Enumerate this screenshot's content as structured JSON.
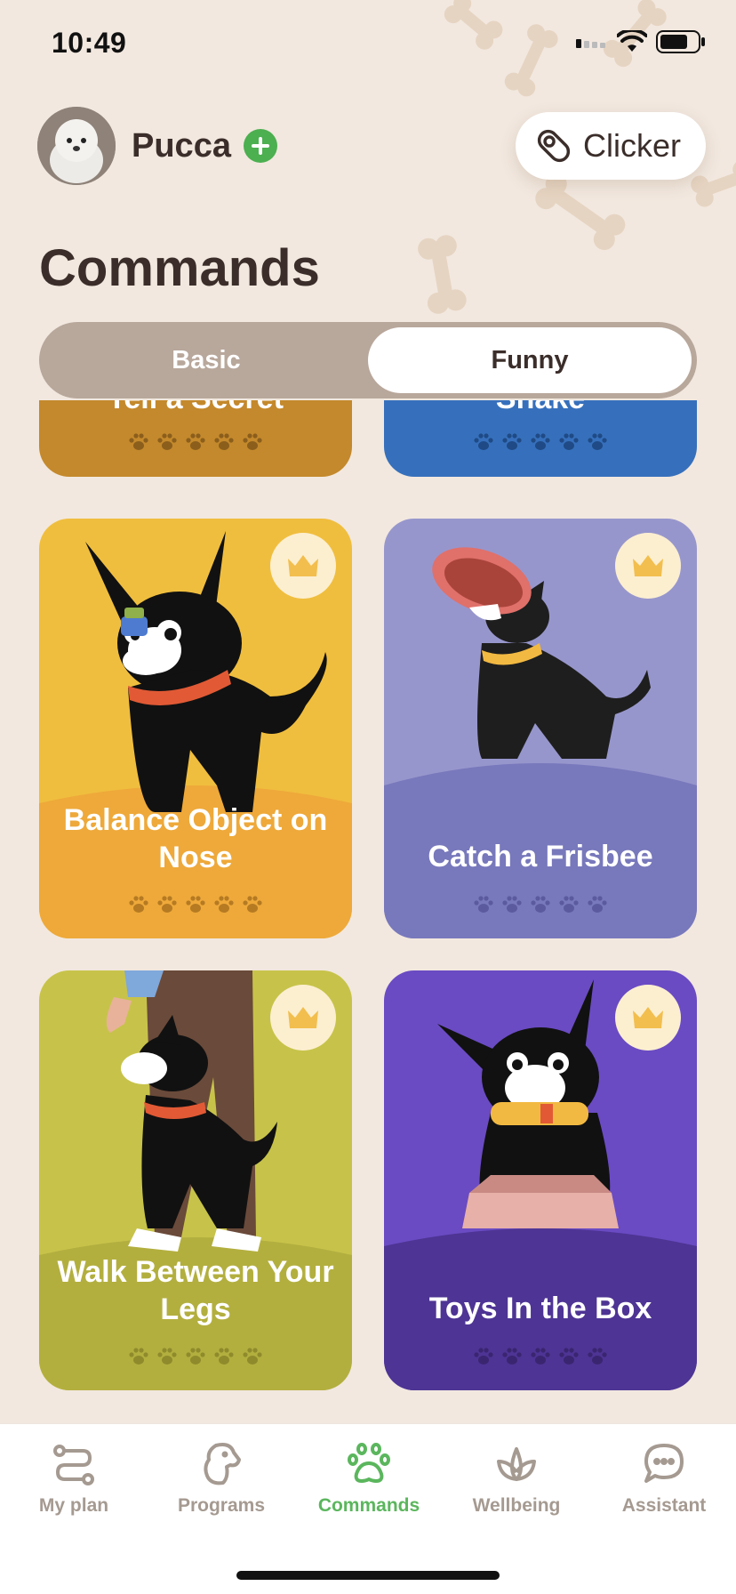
{
  "status_bar": {
    "time": "10:49"
  },
  "header": {
    "pet_name": "Pucca",
    "clicker_label": "Clicker",
    "title": "Commands"
  },
  "segments": [
    {
      "label": "Basic",
      "active": false
    },
    {
      "label": "Funny",
      "active": true
    }
  ],
  "commands": [
    {
      "title": "Tell a Secret",
      "color": "#C4892C",
      "premium": false,
      "paws": 5
    },
    {
      "title": "Shake",
      "color": "#3670BC",
      "premium": false,
      "paws": 5
    },
    {
      "title": "Balance Object on Nose",
      "color": "#F0BE3E",
      "premium": true,
      "paws": 5
    },
    {
      "title": "Catch a Frisbee",
      "color": "#9796CC",
      "premium": true,
      "paws": 5
    },
    {
      "title": "Walk Between Your Legs",
      "color": "#C7C34A",
      "premium": true,
      "paws": 5
    },
    {
      "title": "Toys In the Box",
      "color": "#6A4BC3",
      "premium": true,
      "paws": 5
    }
  ],
  "tabs": [
    {
      "label": "My plan",
      "icon": "plan-icon",
      "active": false
    },
    {
      "label": "Programs",
      "icon": "dog-head-icon",
      "active": false
    },
    {
      "label": "Commands",
      "icon": "paw-icon",
      "active": true
    },
    {
      "label": "Wellbeing",
      "icon": "lotus-icon",
      "active": false
    },
    {
      "label": "Assistant",
      "icon": "chat-icon",
      "active": false
    }
  ]
}
